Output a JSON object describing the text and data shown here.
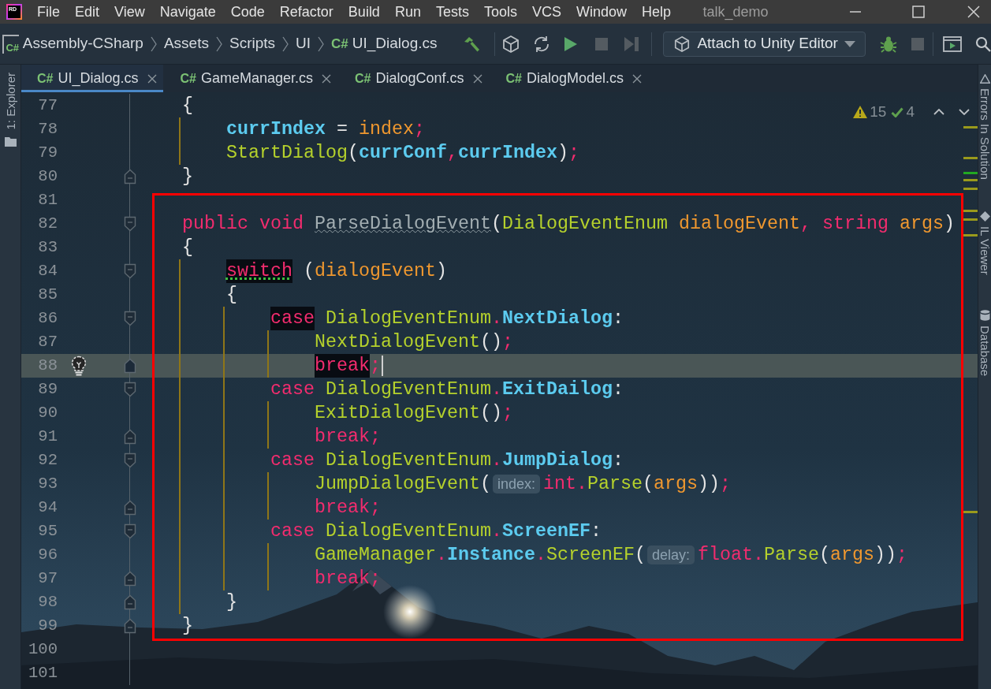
{
  "menu_bar": {
    "logo": "RD",
    "items": [
      "File",
      "Edit",
      "View",
      "Navigate",
      "Code",
      "Refactor",
      "Build",
      "Run",
      "Tests",
      "Tools",
      "VCS",
      "Window",
      "Help"
    ],
    "title": "talk_demo"
  },
  "navigation_bar": {
    "project_icon": "C#",
    "breadcrumbs": [
      {
        "text": "Assembly-CSharp"
      },
      {
        "text": "Assets"
      },
      {
        "text": "Scripts"
      },
      {
        "text": "UI"
      },
      {
        "text": "UI_Dialog.cs",
        "file_icon": "C#"
      }
    ],
    "run_configuration": "Attach to Unity Editor"
  },
  "left_tool_strip": {
    "label": "1: Explorer"
  },
  "tabs": [
    {
      "icon": "C#",
      "label": "UI_Dialog.cs",
      "selected": true
    },
    {
      "icon": "C#",
      "label": "GameManager.cs",
      "selected": false
    },
    {
      "icon": "C#",
      "label": "DialogConf.cs",
      "selected": false
    },
    {
      "icon": "C#",
      "label": "DialogModel.cs",
      "selected": false
    }
  ],
  "editor": {
    "background": {
      "kind": "photo"
    },
    "inspection": {
      "warnings": "15",
      "passed": "4"
    },
    "error_stripe": [
      {
        "color": "#9a9a1c"
      },
      {
        "color": "#9a9a1c"
      },
      {
        "color": "#22a822"
      },
      {
        "color": "#9a9a1c"
      },
      {
        "color": "#9a9a1c"
      },
      {
        "color": "#9a9a1c"
      },
      {
        "color": "#9a9a1c"
      },
      {
        "color": "#9a9a1c"
      },
      {
        "color": "#9a9a1c"
      }
    ],
    "lines": [
      {
        "number": "77",
        "current": false,
        "tokens": [
          {
            "text": "    {",
            "kind": "punct"
          }
        ]
      },
      {
        "number": "78",
        "current": false,
        "tokens": [
          {
            "text": "        currIndex",
            "kind": "field"
          },
          {
            "text": " = ",
            "kind": "punct"
          },
          {
            "text": "index",
            "kind": "param"
          },
          {
            "text": ";",
            "kind": "operator"
          }
        ]
      },
      {
        "number": "79",
        "current": false,
        "tokens": [
          {
            "text": "        StartDialog",
            "kind": "method"
          },
          {
            "text": "(",
            "kind": "punct"
          },
          {
            "text": "currConf",
            "kind": "field"
          },
          {
            "text": ",",
            "kind": "operator"
          },
          {
            "text": "currIndex",
            "kind": "field"
          },
          {
            "text": ")",
            "kind": "punct"
          },
          {
            "text": ";",
            "kind": "operator"
          }
        ]
      },
      {
        "number": "80",
        "current": false,
        "fold_marker": {
          "kind": "end"
        },
        "tokens": [
          {
            "text": "    }",
            "kind": "punct"
          }
        ]
      },
      {
        "number": "81",
        "current": false
      },
      {
        "number": "82",
        "current": false,
        "fold_marker": {
          "kind": "start"
        },
        "tokens": [
          {
            "text": "    public void ",
            "kind": "keyword"
          },
          {
            "text": "ParseDialogEvent",
            "kind": "unused"
          },
          {
            "text": "(",
            "kind": "punct"
          },
          {
            "text": "DialogEventEnum",
            "kind": "type"
          },
          {
            "text": " dialogEvent",
            "kind": "param"
          },
          {
            "text": ",",
            "kind": "operator"
          },
          {
            "text": " string",
            "kind": "keyword"
          },
          {
            "text": " args",
            "kind": "param"
          },
          {
            "text": ")",
            "kind": "punct"
          }
        ]
      },
      {
        "number": "83",
        "current": false,
        "tokens": [
          {
            "text": "    {",
            "kind": "punct"
          }
        ]
      },
      {
        "number": "84",
        "current": false,
        "fold_marker": {
          "kind": "start"
        },
        "tokens": [
          {
            "text": "        switch",
            "kind": "keyword",
            "highlighted": true,
            "suggestion": true
          },
          {
            "text": " (",
            "kind": "punct"
          },
          {
            "text": "dialogEvent",
            "kind": "param"
          },
          {
            "text": ")",
            "kind": "punct"
          }
        ]
      },
      {
        "number": "85",
        "current": false,
        "tokens": [
          {
            "text": "        {",
            "kind": "punct"
          }
        ]
      },
      {
        "number": "86",
        "current": false,
        "fold_marker": {
          "kind": "start"
        },
        "tokens": [
          {
            "text": "            case",
            "kind": "keyword",
            "highlighted": true
          },
          {
            "text": " DialogEventEnum",
            "kind": "type"
          },
          {
            "text": ".",
            "kind": "operator"
          },
          {
            "text": "NextDialog",
            "kind": "field"
          },
          {
            "text": ":",
            "kind": "punct"
          }
        ]
      },
      {
        "number": "87",
        "current": false,
        "tokens": [
          {
            "text": "                NextDialogEvent",
            "kind": "method"
          },
          {
            "text": "()",
            "kind": "punct"
          },
          {
            "text": ";",
            "kind": "operator"
          }
        ]
      },
      {
        "number": "88",
        "current": true,
        "intention_bulb": true,
        "fold_marker": {
          "kind": "end"
        },
        "tokens": [
          {
            "text": "                break",
            "kind": "keyword",
            "highlighted": true
          },
          {
            "text": ";",
            "kind": "operator"
          }
        ]
      },
      {
        "number": "89",
        "current": false,
        "fold_marker": {
          "kind": "start"
        },
        "tokens": [
          {
            "text": "            case",
            "kind": "keyword"
          },
          {
            "text": " DialogEventEnum",
            "kind": "type"
          },
          {
            "text": ".",
            "kind": "operator"
          },
          {
            "text": "ExitDailog",
            "kind": "field"
          },
          {
            "text": ":",
            "kind": "punct"
          }
        ]
      },
      {
        "number": "90",
        "current": false,
        "tokens": [
          {
            "text": "                ExitDialogEvent",
            "kind": "method"
          },
          {
            "text": "()",
            "kind": "punct"
          },
          {
            "text": ";",
            "kind": "operator"
          }
        ]
      },
      {
        "number": "91",
        "current": false,
        "fold_marker": {
          "kind": "end"
        },
        "tokens": [
          {
            "text": "                break",
            "kind": "keyword"
          },
          {
            "text": ";",
            "kind": "operator"
          }
        ]
      },
      {
        "number": "92",
        "current": false,
        "fold_marker": {
          "kind": "start"
        },
        "tokens": [
          {
            "text": "            case",
            "kind": "keyword"
          },
          {
            "text": " DialogEventEnum",
            "kind": "type"
          },
          {
            "text": ".",
            "kind": "operator"
          },
          {
            "text": "JumpDialog",
            "kind": "field"
          },
          {
            "text": ":",
            "kind": "punct"
          }
        ]
      },
      {
        "number": "93",
        "current": false,
        "tokens": [
          {
            "text": "                JumpDialogEvent",
            "kind": "method"
          },
          {
            "text": "(",
            "kind": "punct"
          },
          {
            "text": "index:",
            "kind": "hint"
          },
          {
            "text": "int",
            "kind": "keyword"
          },
          {
            "text": ".",
            "kind": "operator"
          },
          {
            "text": "Parse",
            "kind": "method"
          },
          {
            "text": "(",
            "kind": "punct"
          },
          {
            "text": "args",
            "kind": "param"
          },
          {
            "text": "))",
            "kind": "punct"
          },
          {
            "text": ";",
            "kind": "operator"
          }
        ]
      },
      {
        "number": "94",
        "current": false,
        "fold_marker": {
          "kind": "end"
        },
        "tokens": [
          {
            "text": "                break",
            "kind": "keyword"
          },
          {
            "text": ";",
            "kind": "operator"
          }
        ]
      },
      {
        "number": "95",
        "current": false,
        "fold_marker": {
          "kind": "start"
        },
        "tokens": [
          {
            "text": "            case",
            "kind": "keyword"
          },
          {
            "text": " DialogEventEnum",
            "kind": "type"
          },
          {
            "text": ".",
            "kind": "operator"
          },
          {
            "text": "ScreenEF",
            "kind": "field"
          },
          {
            "text": ":",
            "kind": "punct"
          }
        ]
      },
      {
        "number": "96",
        "current": false,
        "tokens": [
          {
            "text": "                GameManager",
            "kind": "type"
          },
          {
            "text": ".",
            "kind": "operator"
          },
          {
            "text": "Instance",
            "kind": "field"
          },
          {
            "text": ".",
            "kind": "operator"
          },
          {
            "text": "ScreenEF",
            "kind": "method"
          },
          {
            "text": "(",
            "kind": "punct"
          },
          {
            "text": "delay:",
            "kind": "hint"
          },
          {
            "text": "float",
            "kind": "keyword"
          },
          {
            "text": ".",
            "kind": "operator"
          },
          {
            "text": "Parse",
            "kind": "method"
          },
          {
            "text": "(",
            "kind": "punct"
          },
          {
            "text": "args",
            "kind": "param"
          },
          {
            "text": "))",
            "kind": "punct"
          },
          {
            "text": ";",
            "kind": "operator"
          }
        ]
      },
      {
        "number": "97",
        "current": false,
        "fold_marker": {
          "kind": "end"
        },
        "tokens": [
          {
            "text": "                break",
            "kind": "keyword"
          },
          {
            "text": ";",
            "kind": "operator"
          }
        ]
      },
      {
        "number": "98",
        "current": false,
        "fold_marker": {
          "kind": "end"
        },
        "tokens": [
          {
            "text": "        }",
            "kind": "punct"
          }
        ]
      },
      {
        "number": "99",
        "current": false,
        "fold_marker": {
          "kind": "end"
        },
        "tokens": [
          {
            "text": "    }",
            "kind": "punct"
          }
        ]
      },
      {
        "number": "100",
        "current": false
      },
      {
        "number": "101",
        "current": false
      }
    ],
    "annotations": [
      {
        "kind": "frame"
      }
    ]
  },
  "right_tool_strip": {
    "labels": [
      "Errors In Solution",
      "IL Viewer",
      "Database"
    ]
  }
}
